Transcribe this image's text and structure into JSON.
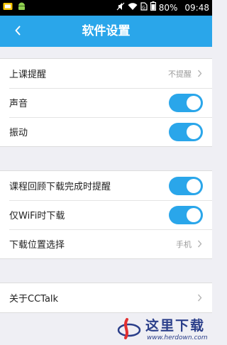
{
  "status_bar": {
    "battery_percent": "80%",
    "time": "09:48",
    "icons": [
      "app-notification-icon",
      "android-icon",
      "mute-icon",
      "wifi-icon",
      "sim-icon",
      "battery-icon"
    ]
  },
  "app_bar": {
    "title": "软件设置",
    "back_icon": "chevron-left-icon",
    "background": "#2aa6ea"
  },
  "groups": {
    "reminders": {
      "items": [
        {
          "label": "上课提醒",
          "value": "不提醒",
          "control": "disclosure"
        },
        {
          "label": "声音",
          "control": "toggle",
          "state": "on"
        },
        {
          "label": "振动",
          "control": "toggle",
          "state": "on"
        }
      ]
    },
    "download": {
      "items": [
        {
          "label": "课程回顾下载完成时提醒",
          "control": "toggle",
          "state": "on"
        },
        {
          "label": "仅WiFi时下载",
          "control": "toggle",
          "state": "on"
        },
        {
          "label": "下载位置选择",
          "value": "手机",
          "control": "disclosure"
        }
      ]
    },
    "about": {
      "items": [
        {
          "label": "关于CCTalk",
          "control": "disclosure"
        }
      ]
    }
  },
  "watermark": {
    "text": "这里下载",
    "url": "www.herdown.com"
  },
  "colors": {
    "accent": "#2aa6ea",
    "page_background": "#efeff4",
    "row_background": "#ffffff"
  }
}
